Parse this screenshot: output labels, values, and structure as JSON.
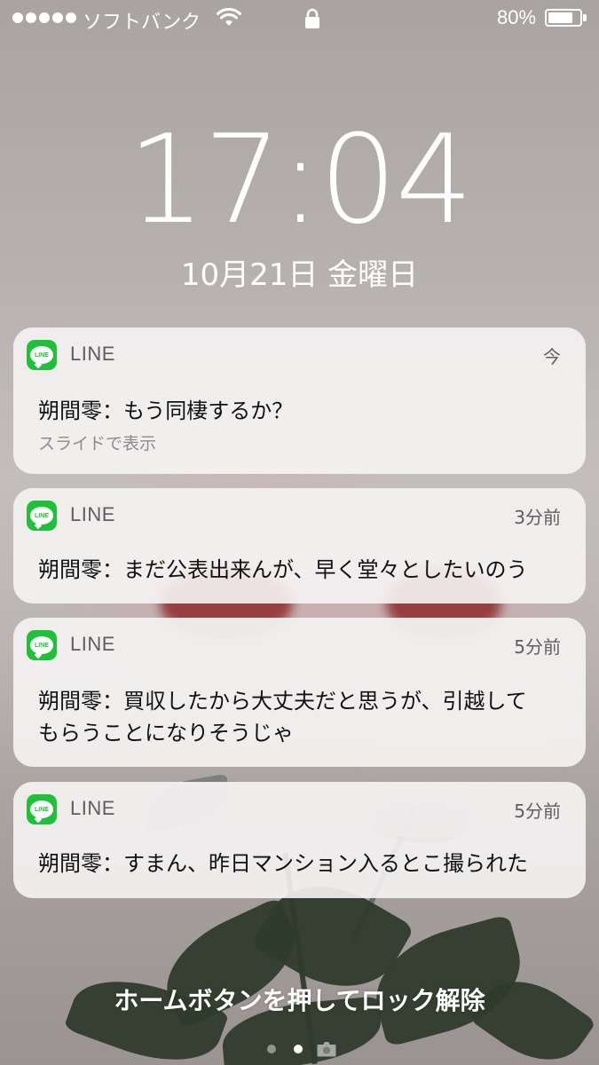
{
  "status_bar": {
    "carrier": "ソフトバンク",
    "battery_percent": "80%",
    "battery_level": 0.8,
    "icons": [
      "signal-dots-icon",
      "wifi-icon",
      "lock-icon",
      "battery-icon"
    ]
  },
  "lock_screen": {
    "time": "17:04",
    "date": "10月21日 金曜日",
    "unlock_hint": "ホームボタンを押してロック解除"
  },
  "notifications": [
    {
      "app": "LINE",
      "time": "今",
      "message": "朔間零：もう同棲するか？",
      "action_hint": "スライドで表示",
      "icon": "line-app-icon"
    },
    {
      "app": "LINE",
      "time": "3分前",
      "message": "朔間零：まだ公表出来んが、早く堂々としたいのう",
      "icon": "line-app-icon"
    },
    {
      "app": "LINE",
      "time": "5分前",
      "message": "朔間零：買収したから大丈夫だと思うが、引越して\nもらうことになりそうじゃ",
      "icon": "line-app-icon"
    },
    {
      "app": "LINE",
      "time": "5分前",
      "message": "朔間零：すまん、昨日マンション入るとこ撮られた",
      "icon": "line-app-icon"
    }
  ],
  "page_indicator": {
    "pages": 2,
    "current": 2,
    "extra_icon": "camera-icon"
  },
  "colors": {
    "line_green": "#1fc13b",
    "card_background": "#f6f4f4",
    "secondary_text": "#5f5d5d"
  }
}
